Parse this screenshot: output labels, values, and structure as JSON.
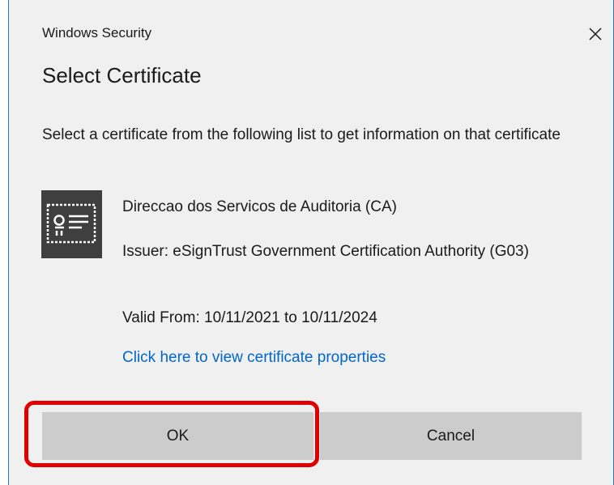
{
  "window": {
    "title": "Windows Security",
    "close_icon": "close-icon"
  },
  "dialog": {
    "heading": "Select Certificate",
    "description": "Select a certificate from the following list to get information on that certificate"
  },
  "certificate": {
    "icon": "certificate-icon",
    "name": "Direccao dos Servicos de Auditoria (CA)",
    "issuer": "Issuer: eSignTrust Government Certification Authority (G03)",
    "valid": "Valid From: 10/11/2021 to 10/11/2024",
    "link": "Click here to view certificate properties"
  },
  "buttons": {
    "ok": "OK",
    "cancel": "Cancel"
  },
  "colors": {
    "dialog_background": "#f0f0f0",
    "window_border": "#2b78d0",
    "button_background": "#cccccc",
    "link": "#0066cc",
    "highlight": "#e00000",
    "icon_dark": "#3f3f3f"
  }
}
